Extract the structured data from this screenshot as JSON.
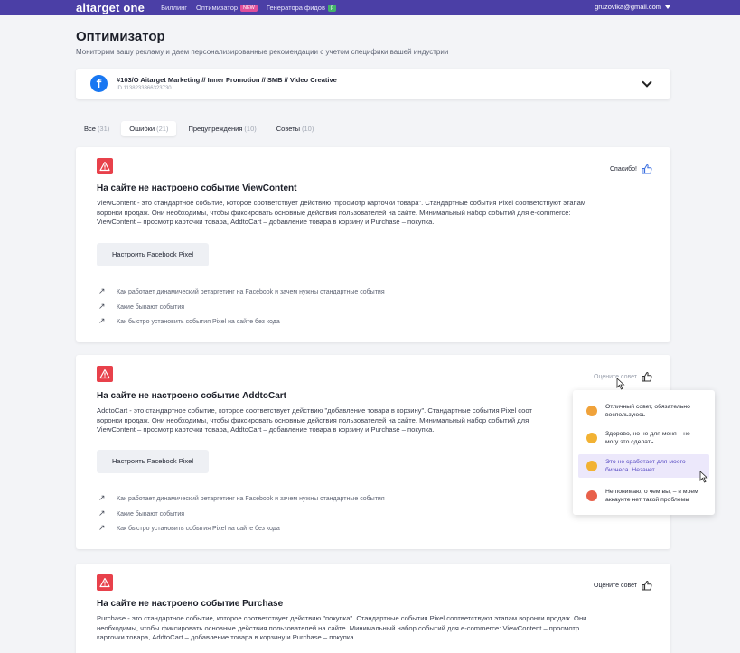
{
  "topbar": {
    "logo": "aitarget one",
    "nav": [
      {
        "label": "Биллинг"
      },
      {
        "label": "Оптимизатор",
        "badge": "NEW"
      },
      {
        "label": "Генератора фидов",
        "badge": "β"
      }
    ],
    "user_email": "gruzovika@gmail.com"
  },
  "page": {
    "title": "Оптимизатор",
    "subtitle": "Мониторим вашу рекламу и даем персонализированные рекомендации с учетом специфики вашей индустрии"
  },
  "account": {
    "name": "#103/O Aitarget Marketing // Inner Promotion // SMB // Video Creative",
    "id": "ID 1138233366323730"
  },
  "tabs": [
    {
      "label": "Все",
      "count": "(31)"
    },
    {
      "label": "Ошибки",
      "count": "(21)"
    },
    {
      "label": "Предупреждения",
      "count": "(10)"
    },
    {
      "label": "Советы",
      "count": "(10)"
    }
  ],
  "cards": [
    {
      "rate_label": "Спасибо!",
      "title": "На сайте не настроено событие ViewContent",
      "lines": [
        "ViewContent - это стандартное событие, которое соответствует действию \"просмотр карточки товара\". Стандартные события Pixel соответствуют этапам",
        "воронки продаж. Они необходимы, чтобы фиксировать основные действия пользователей на сайте. Минимальный набор событий для e-commerce:",
        "ViewContent – просмотр карточки товара, AddtoCart – добавление товара в корзину и Purchase – покупка."
      ],
      "button": "Настроить Facebook Pixel",
      "links": [
        "Как работает динамический ретаргетинг на Facebook и зачем нужны стандартные события",
        "Какие бывают события",
        "Как быстро установить события Pixel на сайте без кода"
      ]
    },
    {
      "rate_label": "Оцените совет",
      "title": "На сайте не настроено событие AddtoCart",
      "lines": [
        "AddtoCart - это стандартное событие, которое соответствует действию \"добавление товара в корзину\". Стандартные события Pixel соот",
        "воронки продаж. Они необходимы, чтобы фиксировать основные действия пользователей на сайте. Минимальный набор событий для",
        "ViewContent – просмотр карточки товара, AddtoCart – добавление товара в корзину и Purchase – покупка."
      ],
      "button": "Настроить Facebook Pixel",
      "links": [
        "Как работает динамический ретаргетинг на Facebook и зачем нужны стандартные события",
        "Какие бывают события",
        "Как быстро установить события Pixel на сайте без кода"
      ]
    },
    {
      "rate_label": "Оцените совет",
      "title": "На сайте не настроено событие Purchase",
      "lines": [
        "Purchase - это стандартное событие, которое соответствует действию \"покупка\". Стандартные события Pixel соответствуют этапам воронки продаж. Они",
        "необходимы, чтобы фиксировать основные действия пользователей на сайте. Минимальный набор событий для e-commerce: ViewContent – просмотр",
        "карточки товара, AddtoCart – добавление товара в корзину и Purchase – покупка."
      ]
    }
  ],
  "rating_popup": {
    "options": [
      {
        "emoji": "heart-eyes-emoji",
        "lines": [
          "Отличный совет, обязательно",
          "воспользуюсь"
        ]
      },
      {
        "emoji": "neutral-emoji",
        "lines": [
          "Здорово, но не для меня – не",
          "могу это сделать"
        ]
      },
      {
        "emoji": "thinking-emoji",
        "lines": [
          "Это не сработает для моего",
          "бизнеса. Незачет"
        ]
      },
      {
        "emoji": "angry-emoji",
        "lines": [
          "Не понимаю, о чем вы, – в моем",
          "аккаунте нет такой проблемы"
        ]
      }
    ]
  },
  "colors": {
    "topbar": "#4b3fa6",
    "warning": "#e8414b",
    "facebook": "#1877f2",
    "hover": "#ece8fb"
  }
}
